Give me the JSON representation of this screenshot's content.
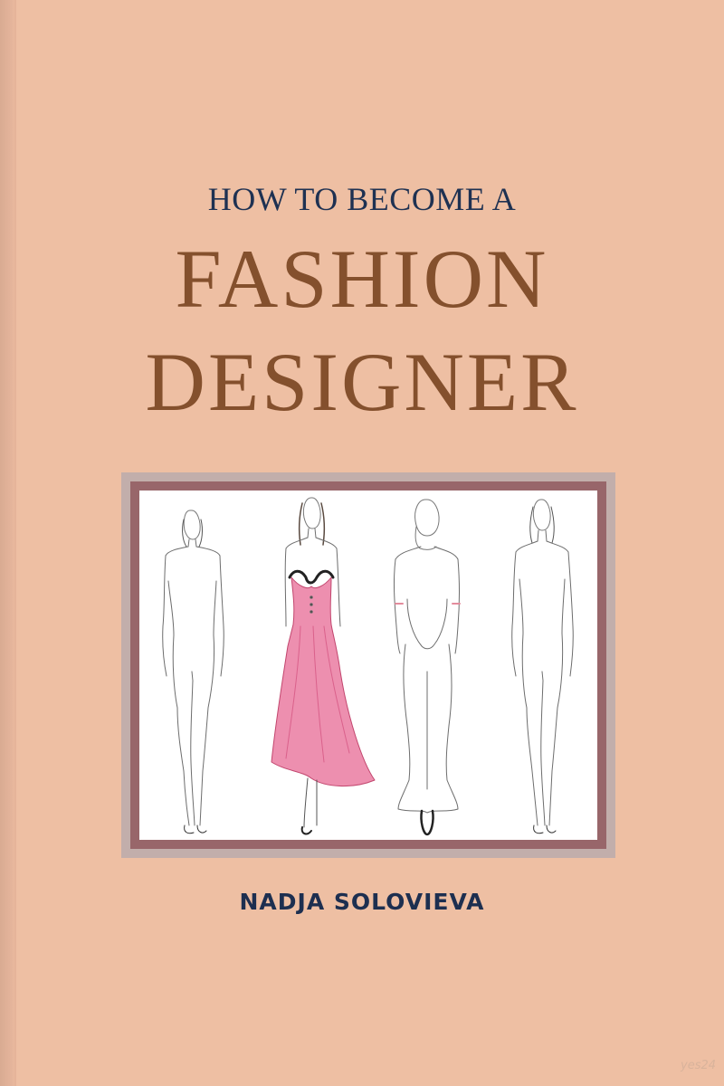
{
  "cover": {
    "subtitle": "HOW TO BECOME A",
    "title_line1": "FASHION",
    "title_line2": "DESIGNER",
    "author": "NADJA SOLOVIEVA",
    "watermark": "yes24"
  },
  "illustration": {
    "figures": [
      {
        "name": "croquis-front-1"
      },
      {
        "name": "croquis-pink-gown"
      },
      {
        "name": "croquis-back-view"
      },
      {
        "name": "croquis-front-2"
      }
    ]
  },
  "colors": {
    "background": "#eebfa3",
    "subtitle": "#1e3152",
    "title": "#84502d",
    "author": "#1d2f50",
    "frame_outer": "#c2aeab",
    "frame_mid": "#98666a",
    "gown": "#e9739b"
  }
}
